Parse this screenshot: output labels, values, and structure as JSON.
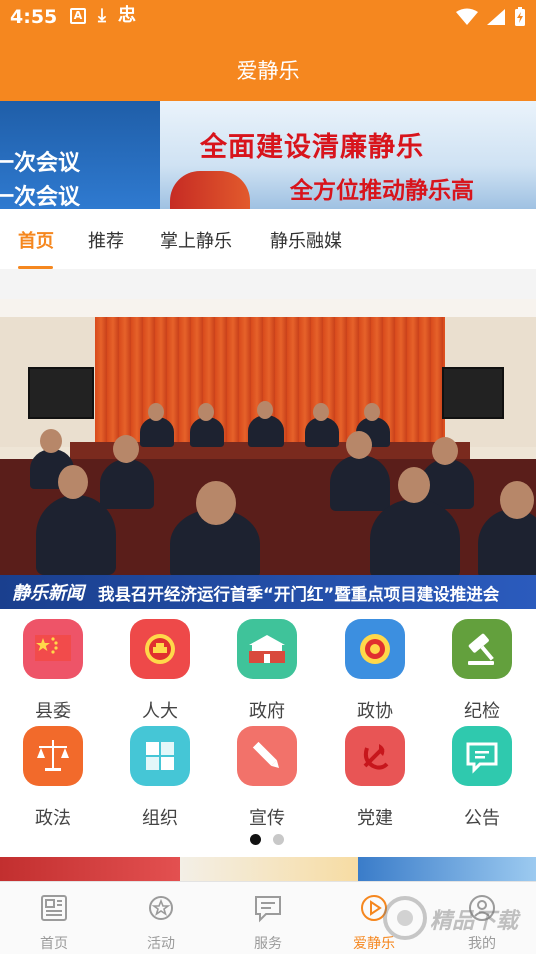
{
  "status_bar": {
    "time": "4:55",
    "left_icons": [
      "text-a-icon",
      "download-icon",
      "bug-icon"
    ],
    "right_icons": [
      "wifi-icon",
      "signal-icon",
      "battery-charging-icon"
    ]
  },
  "app": {
    "title": "爱静乐",
    "accent": "#f5871f"
  },
  "banner": {
    "left_line_1": "一次会议",
    "left_line_2": "一次会议",
    "right_line_1": "全面建设清廉静乐",
    "right_line_2": "全方位推动静乐高"
  },
  "tabs": [
    {
      "label": "首页",
      "active": true
    },
    {
      "label": "推荐",
      "active": false
    },
    {
      "label": "掌上静乐",
      "active": false
    },
    {
      "label": "静乐融媒",
      "active": false
    }
  ],
  "hero": {
    "channel_logo": "静乐新闻",
    "headline": "我县召开经济运行首季“开门红”暨重点项目建设推进会"
  },
  "grid": [
    {
      "label": "县委",
      "icon": "flag-icon",
      "color": "#ee5468"
    },
    {
      "label": "人大",
      "icon": "emblem-icon",
      "color": "#ee4949"
    },
    {
      "label": "政府",
      "icon": "tiananmen-icon",
      "color": "#3fc39a"
    },
    {
      "label": "政协",
      "icon": "cppcc-emblem-icon",
      "color": "#3c8fe0"
    },
    {
      "label": "纪检",
      "icon": "gavel-icon",
      "color": "#63a03d"
    },
    {
      "label": "政法",
      "icon": "scales-icon",
      "color": "#f26a2b"
    },
    {
      "label": "组织",
      "icon": "puzzle-icon",
      "color": "#45c6d6"
    },
    {
      "label": "宣传",
      "icon": "pencil-icon",
      "color": "#f2726a"
    },
    {
      "label": "党建",
      "icon": "party-emblem-icon",
      "color": "#e85555"
    },
    {
      "label": "公告",
      "icon": "chat-notice-icon",
      "color": "#2fc9ae"
    }
  ],
  "pager": {
    "pages": 2,
    "current": 1
  },
  "bottom_nav": [
    {
      "label": "首页",
      "icon": "news-icon",
      "active": false
    },
    {
      "label": "活动",
      "icon": "medal-icon",
      "active": false
    },
    {
      "label": "服务",
      "icon": "service-chat-icon",
      "active": false
    },
    {
      "label": "爱静乐",
      "icon": "play-circle-icon",
      "active": true
    },
    {
      "label": "我的",
      "icon": "person-icon",
      "active": false
    }
  ],
  "watermark": {
    "text": "精品下载"
  }
}
